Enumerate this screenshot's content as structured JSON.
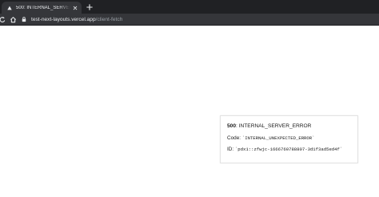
{
  "browser": {
    "tab": {
      "title": "500: INTERNAL_SERVER_ERROR",
      "favicon": "vercel-triangle-icon"
    },
    "new_tab_icon": "plus-icon",
    "toolbar": {
      "reload_icon": "reload-icon",
      "home_icon": "home-icon",
      "lock_icon": "lock-icon",
      "url_host": "test-next-layouts.vercel.app",
      "url_path": "/client-fetch"
    },
    "colors": {
      "tabstrip_bg": "#202124",
      "toolbar_bg": "#35363a",
      "text_light": "#e8eaed",
      "text_dim": "#9aa0a6"
    }
  },
  "error": {
    "status_code": "500",
    "separator": ": ",
    "status_text": "INTERNAL_SERVER_ERROR",
    "code_label": "Code: ",
    "code_value": "`INTERNAL_UNEXPECTED_ERROR`",
    "id_label": "ID: ",
    "id_value": "`pdx1::zfwjc-1666760788807-3d1f3ad5ed4f`"
  }
}
